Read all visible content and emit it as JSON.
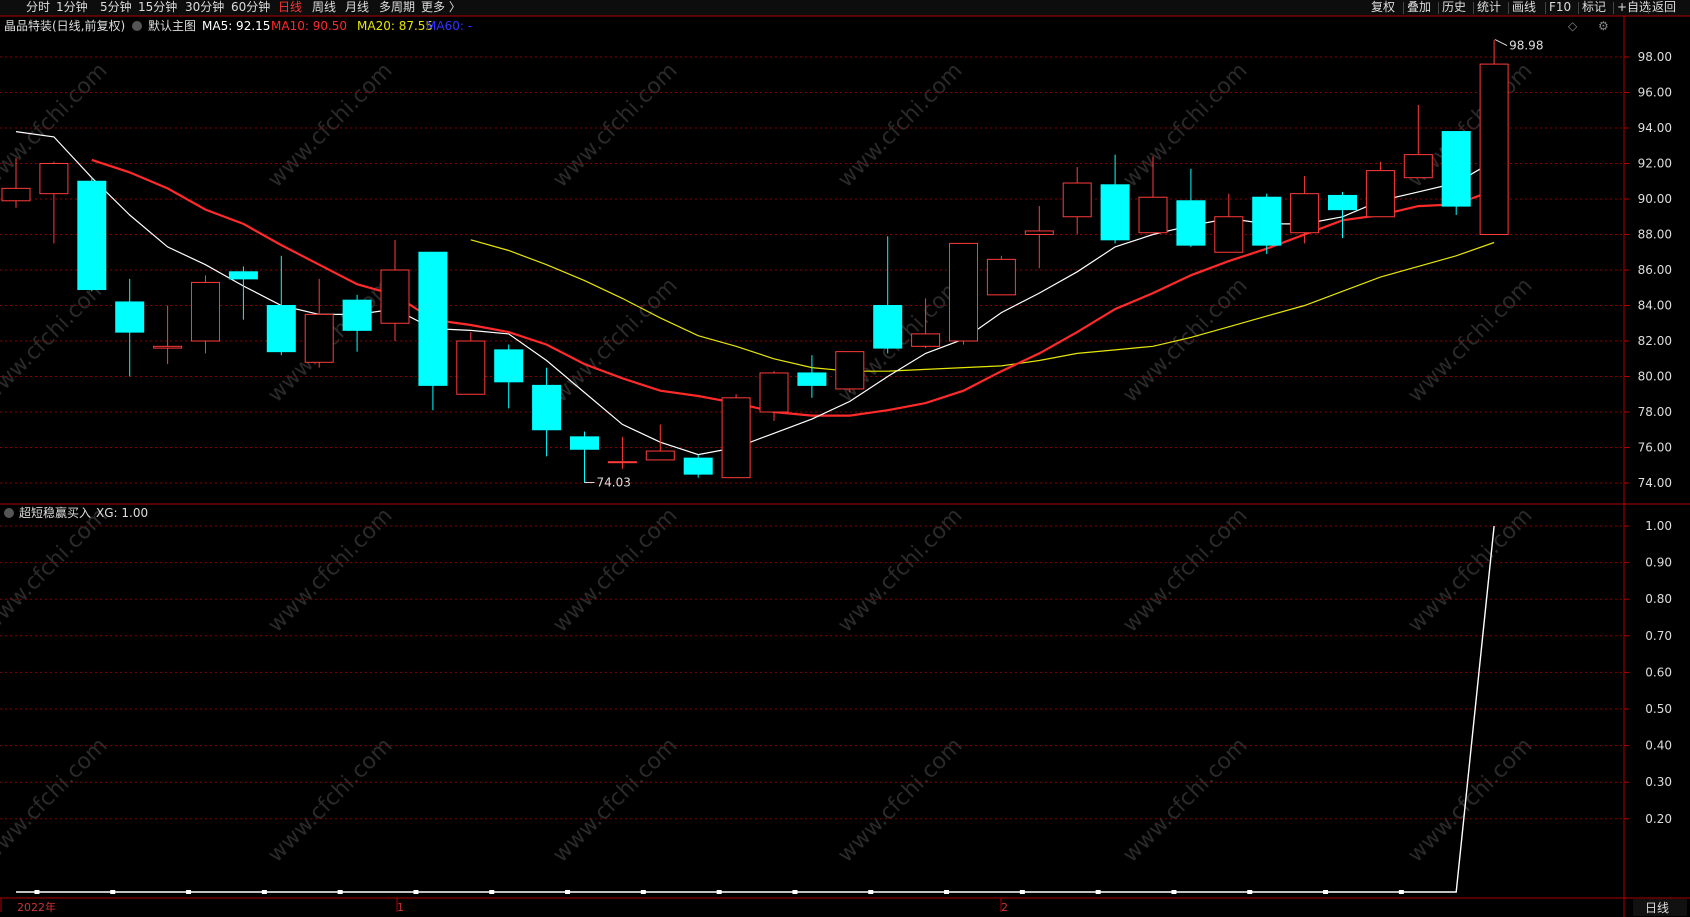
{
  "toolbar": {
    "periods": [
      "分时",
      "1分钟",
      "5分钟",
      "15分钟",
      "30分钟",
      "60分钟",
      "日线",
      "周线",
      "月线",
      "多周期",
      "更多 〉"
    ],
    "active_period": "日线",
    "tools": [
      "复权",
      "叠加",
      "历史",
      "统计",
      "画线",
      "F10",
      "标记",
      "+自选",
      "返回"
    ]
  },
  "main_panel": {
    "stock_title": "晶品特装(日线,前复权)",
    "template": "默认主图",
    "ma_labels": [
      {
        "text": "MA5: 92.15",
        "color": "#ffffff"
      },
      {
        "text": "MA10: 90.50",
        "color": "#ff2a2a"
      },
      {
        "text": "MA20: 87.55",
        "color": "#e6e600"
      },
      {
        "text": "MA60: -",
        "color": "#3333ff"
      }
    ],
    "high_label": "98.98",
    "low_label": "74.03",
    "y_ticks": [
      "74.00",
      "76.00",
      "78.00",
      "80.00",
      "82.00",
      "84.00",
      "86.00",
      "88.00",
      "90.00",
      "92.00",
      "94.00",
      "96.00",
      "98.00"
    ]
  },
  "indicator_panel": {
    "title": "超短稳赢买入",
    "xg_label": "XG: 1.00",
    "y_ticks": [
      "0.20",
      "0.30",
      "0.40",
      "0.50",
      "0.60",
      "0.70",
      "0.80",
      "0.90",
      "1.00"
    ]
  },
  "x_axis": {
    "labels": [
      "2022年",
      "1",
      "2"
    ],
    "period_label": "日线"
  },
  "watermark": "www.cfchi.com",
  "colors": {
    "up": "#ff3b3b",
    "down": "#00ffff",
    "grid": "#8a0000",
    "frame": "#b00000",
    "ma5": "#ffffff",
    "ma10": "#ff2a2a",
    "ma20": "#e6e600",
    "xg": "#ffffff"
  },
  "chart_data": {
    "type": "candlestick",
    "price_ylim": [
      73.2,
      99.5
    ],
    "indicator_ylim": [
      0,
      1.04
    ],
    "candles": [
      {
        "o": 89.9,
        "h": 92.3,
        "l": 89.5,
        "c": 90.6
      },
      {
        "o": 90.3,
        "h": 92.1,
        "l": 87.5,
        "c": 92.0
      },
      {
        "o": 91.0,
        "h": 91.2,
        "l": 84.8,
        "c": 84.9
      },
      {
        "o": 84.2,
        "h": 85.5,
        "l": 80.0,
        "c": 82.5
      },
      {
        "o": 81.6,
        "h": 84.0,
        "l": 80.7,
        "c": 81.7
      },
      {
        "o": 82.0,
        "h": 85.7,
        "l": 81.3,
        "c": 85.3
      },
      {
        "o": 85.9,
        "h": 86.2,
        "l": 83.2,
        "c": 85.5
      },
      {
        "o": 84.0,
        "h": 86.8,
        "l": 81.2,
        "c": 81.4
      },
      {
        "o": 80.8,
        "h": 85.5,
        "l": 80.5,
        "c": 83.5
      },
      {
        "o": 84.3,
        "h": 84.6,
        "l": 81.4,
        "c": 82.6
      },
      {
        "o": 83.0,
        "h": 87.7,
        "l": 82.0,
        "c": 86.0
      },
      {
        "o": 87.0,
        "h": 87.0,
        "l": 78.1,
        "c": 79.5
      },
      {
        "o": 79.0,
        "h": 82.5,
        "l": 79.0,
        "c": 82.0
      },
      {
        "o": 81.5,
        "h": 81.8,
        "l": 78.2,
        "c": 79.7
      },
      {
        "o": 79.5,
        "h": 80.5,
        "l": 75.5,
        "c": 77.0
      },
      {
        "o": 76.6,
        "h": 76.9,
        "l": 74.0,
        "c": 75.9
      },
      {
        "o": 75.2,
        "h": 76.6,
        "l": 74.8,
        "c": 75.2
      },
      {
        "o": 75.3,
        "h": 77.3,
        "l": 75.3,
        "c": 75.8
      },
      {
        "o": 75.4,
        "h": 75.6,
        "l": 74.3,
        "c": 74.5
      },
      {
        "o": 74.3,
        "h": 79.0,
        "l": 74.3,
        "c": 78.8
      },
      {
        "o": 78.0,
        "h": 80.3,
        "l": 77.5,
        "c": 80.2
      },
      {
        "o": 80.2,
        "h": 81.2,
        "l": 78.8,
        "c": 79.5
      },
      {
        "o": 79.3,
        "h": 81.3,
        "l": 79.1,
        "c": 81.4
      },
      {
        "o": 84.0,
        "h": 87.9,
        "l": 81.3,
        "c": 81.6
      },
      {
        "o": 81.7,
        "h": 84.4,
        "l": 81.6,
        "c": 82.4
      },
      {
        "o": 82.0,
        "h": 87.5,
        "l": 81.8,
        "c": 87.5
      },
      {
        "o": 84.6,
        "h": 86.8,
        "l": 84.6,
        "c": 86.6
      },
      {
        "o": 88.0,
        "h": 89.6,
        "l": 86.1,
        "c": 88.2
      },
      {
        "o": 89.0,
        "h": 91.8,
        "l": 88.0,
        "c": 90.9
      },
      {
        "o": 90.8,
        "h": 92.5,
        "l": 87.5,
        "c": 87.7
      },
      {
        "o": 88.1,
        "h": 92.4,
        "l": 88.1,
        "c": 90.1
      },
      {
        "o": 89.9,
        "h": 91.7,
        "l": 87.3,
        "c": 87.4
      },
      {
        "o": 87.0,
        "h": 90.3,
        "l": 87.0,
        "c": 89.0
      },
      {
        "o": 90.1,
        "h": 90.3,
        "l": 86.9,
        "c": 87.4
      },
      {
        "o": 88.1,
        "h": 91.3,
        "l": 87.5,
        "c": 90.3
      },
      {
        "o": 90.2,
        "h": 90.4,
        "l": 87.8,
        "c": 89.4
      },
      {
        "o": 89.0,
        "h": 92.1,
        "l": 89.0,
        "c": 91.6
      },
      {
        "o": 91.2,
        "h": 95.3,
        "l": 91.2,
        "c": 92.5
      },
      {
        "o": 93.8,
        "h": 93.8,
        "l": 89.1,
        "c": 89.6
      },
      {
        "o": 88.0,
        "h": 98.98,
        "l": 88.0,
        "c": 97.6
      }
    ],
    "ma5": [
      93.8,
      93.5,
      91.2,
      89.1,
      87.3,
      86.3,
      85.1,
      84.0,
      83.5,
      83.5,
      83.8,
      82.7,
      82.6,
      82.4,
      80.9,
      79.1,
      77.3,
      76.3,
      75.6,
      76.0,
      76.8,
      77.6,
      78.6,
      80.0,
      81.3,
      82.1,
      83.6,
      84.7,
      85.9,
      87.3,
      88.0,
      88.5,
      88.9,
      88.6,
      88.6,
      89.0,
      89.9,
      90.4,
      90.9,
      92.15
    ],
    "ma10": [
      null,
      null,
      92.2,
      91.5,
      90.6,
      89.4,
      88.6,
      87.4,
      86.3,
      85.2,
      84.6,
      83.2,
      82.9,
      82.5,
      81.8,
      80.7,
      79.9,
      79.2,
      78.9,
      78.5,
      78.0,
      77.8,
      77.8,
      78.1,
      78.5,
      79.2,
      80.3,
      81.3,
      82.5,
      83.8,
      84.7,
      85.7,
      86.5,
      87.2,
      88.0,
      88.8,
      89.1,
      89.6,
      89.7,
      90.5
    ],
    "ma20": [
      null,
      null,
      null,
      null,
      null,
      null,
      null,
      null,
      null,
      null,
      null,
      null,
      87.7,
      87.1,
      86.3,
      85.4,
      84.4,
      83.3,
      82.3,
      81.7,
      81.0,
      80.5,
      80.3,
      80.3,
      80.4,
      80.5,
      80.6,
      80.9,
      81.3,
      81.5,
      81.7,
      82.2,
      82.8,
      83.4,
      84.0,
      84.8,
      85.6,
      86.2,
      86.8,
      87.55
    ],
    "xg": [
      0,
      0,
      0,
      0,
      0,
      0,
      0,
      0,
      0,
      0,
      0,
      0,
      0,
      0,
      0,
      0,
      0,
      0,
      0,
      0,
      0,
      0,
      0,
      0,
      0,
      0,
      0,
      0,
      0,
      0,
      0,
      0,
      0,
      0,
      0,
      0,
      0,
      0,
      0,
      1
    ]
  }
}
